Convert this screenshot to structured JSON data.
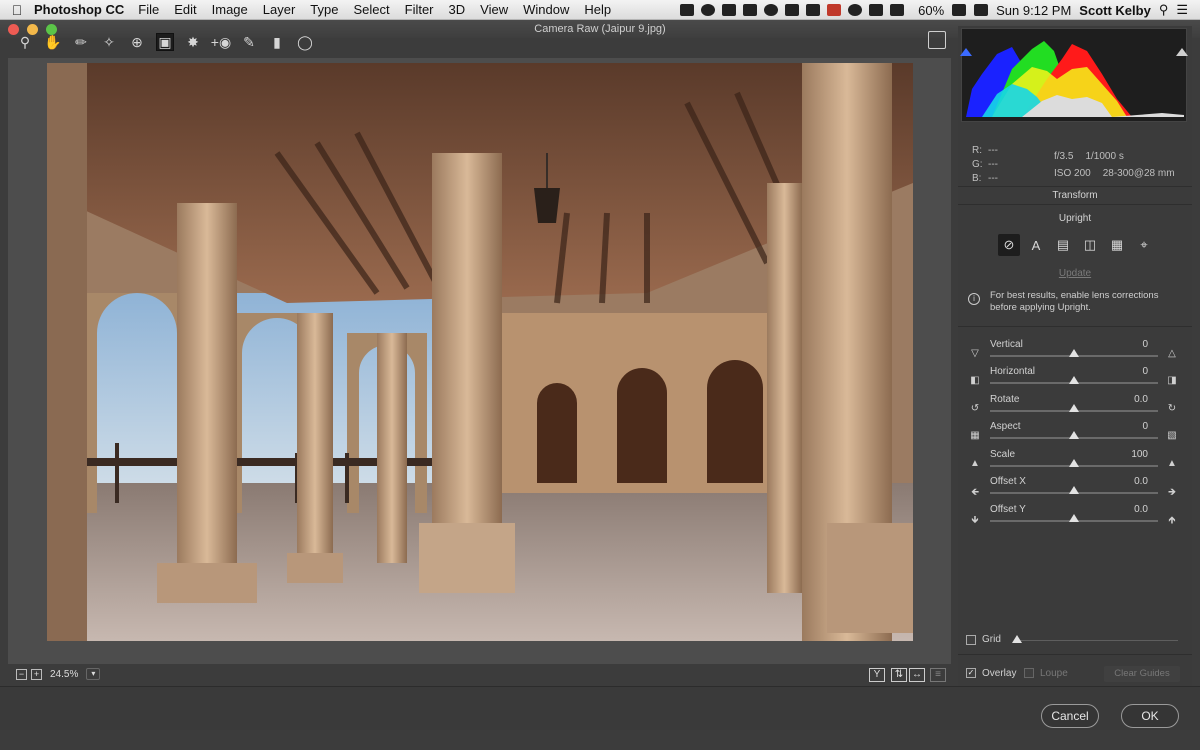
{
  "menubar": {
    "app_name": "Photoshop CC",
    "menus": [
      "File",
      "Edit",
      "Image",
      "Layer",
      "Type",
      "Select",
      "Filter",
      "3D",
      "View",
      "Window",
      "Help"
    ],
    "battery": "60%",
    "clock": "Sun 9:12 PM",
    "user": "Scott Kelby"
  },
  "window": {
    "title": "Camera Raw (Jaipur 9.jpg)"
  },
  "toolbar": {
    "tools": [
      "zoom-icon",
      "hand-icon",
      "white-balance-icon",
      "color-sampler-icon",
      "targeted-adjustment-icon",
      "transform-icon",
      "spot-removal-icon",
      "red-eye-icon",
      "adjustment-brush-icon",
      "graduated-filter-icon",
      "radial-filter-icon"
    ],
    "active_tool": "transform-icon"
  },
  "status": {
    "zoom": "24.5%"
  },
  "info": {
    "r_label": "R:",
    "r_value": "---",
    "g_label": "G:",
    "g_value": "---",
    "b_label": "B:",
    "b_value": "---",
    "aperture": "f/3.5",
    "shutter": "1/1000 s",
    "iso": "ISO 200",
    "lens": "28-300@28 mm"
  },
  "panel": {
    "title": "Transform",
    "upright_label": "Upright",
    "update_label": "Update",
    "tip": "For best results, enable lens corrections before applying Upright.",
    "sliders": [
      {
        "label": "Vertical",
        "value": "0",
        "level": 0.5
      },
      {
        "label": "Horizontal",
        "value": "0",
        "level": 0.5
      },
      {
        "label": "Rotate",
        "value": "0.0",
        "level": 0.5
      },
      {
        "label": "Aspect",
        "value": "0",
        "level": 0.5
      },
      {
        "label": "Scale",
        "value": "100",
        "level": 0.5
      },
      {
        "label": "Offset X",
        "value": "0.0",
        "level": 0.5
      },
      {
        "label": "Offset Y",
        "value": "0.0",
        "level": 0.5
      }
    ],
    "grid_label": "Grid",
    "overlay_label": "Overlay",
    "loupe_label": "Loupe",
    "clear_guides_label": "Clear Guides"
  },
  "buttons": {
    "cancel": "Cancel",
    "ok": "OK"
  },
  "colors": {
    "accent": "#3b3b3b",
    "histogram_red": "#ff1a1a",
    "histogram_green": "#22dd22",
    "histogram_blue": "#1a22ff",
    "histogram_yellow": "#f5f51a",
    "histogram_cyan": "#16d6e8"
  }
}
